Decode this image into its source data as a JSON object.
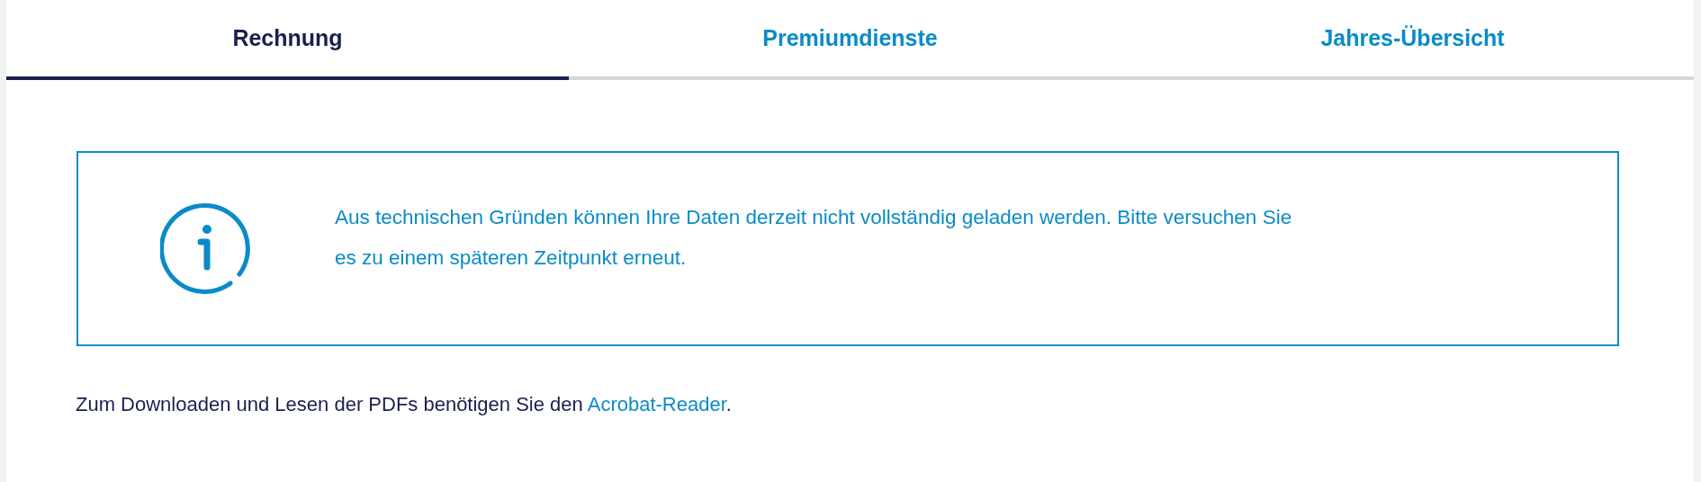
{
  "tabs": [
    {
      "label": "Rechnung",
      "selected": true
    },
    {
      "label": "Premiumdienste",
      "selected": false
    },
    {
      "label": "Jahres-Übersicht",
      "selected": false
    }
  ],
  "notice": {
    "message": "Aus technischen Gründen können Ihre Daten derzeit nicht vollständig geladen werden. Bitte versuchen Sie es zu einem späteren Zeitpunkt erneut."
  },
  "footer": {
    "text": "Zum Downloaden und Lesen der PDFs benötigen Sie den ",
    "link": "Acrobat-Reader",
    "suffix": "."
  }
}
